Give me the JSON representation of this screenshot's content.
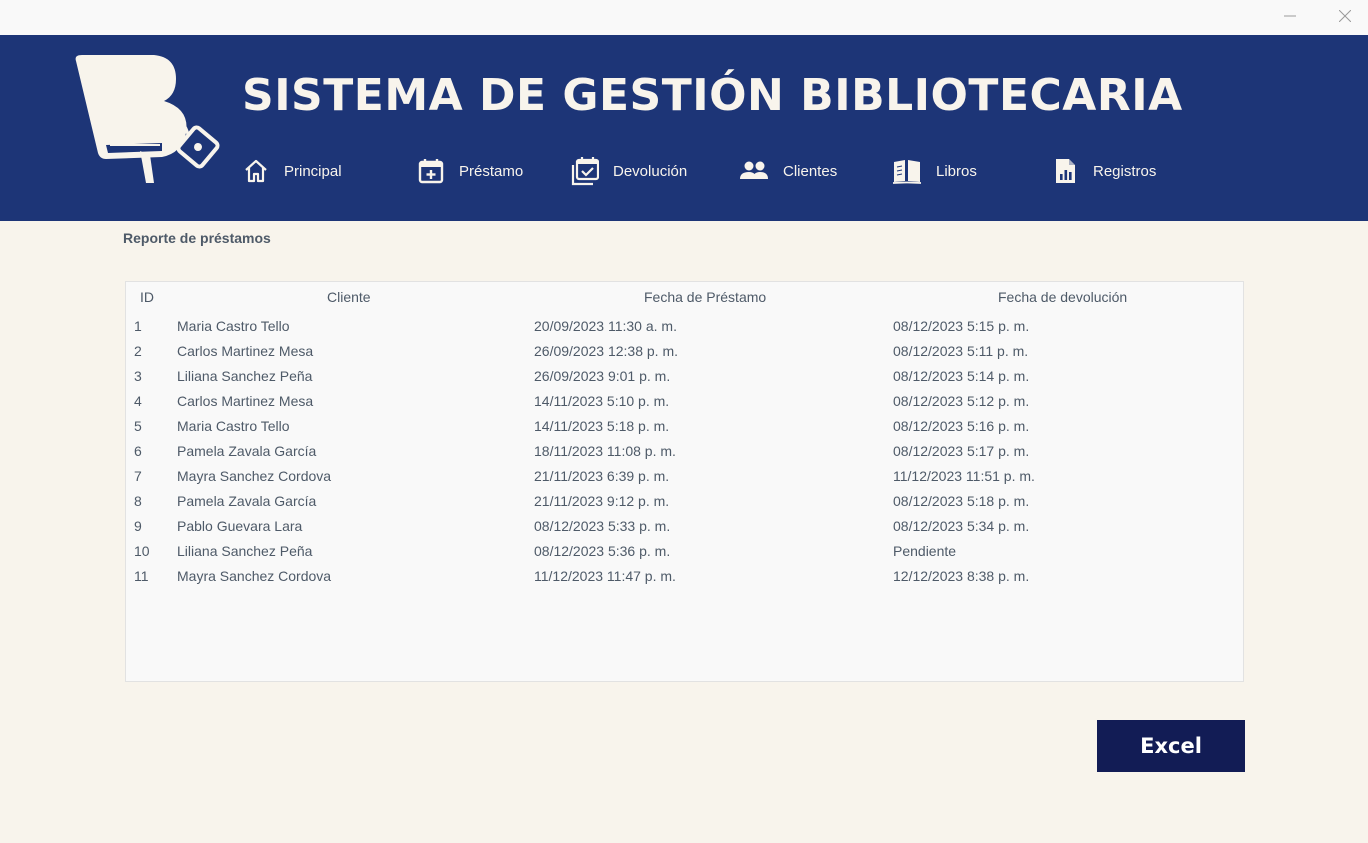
{
  "window": {
    "minimize_icon": "minimize-icon",
    "close_icon": "close-icon"
  },
  "header": {
    "title": "SISTEMA DE GESTIÓN BIBLIOTECARIA",
    "logo_letter": "B",
    "nav": [
      {
        "label": "Principal",
        "icon": "home-icon"
      },
      {
        "label": "Préstamo",
        "icon": "calendar-add-icon"
      },
      {
        "label": "Devolución",
        "icon": "calendar-check-icon"
      },
      {
        "label": "Clientes",
        "icon": "users-icon"
      },
      {
        "label": "Libros",
        "icon": "book-icon"
      },
      {
        "label": "Registros",
        "icon": "report-icon"
      }
    ]
  },
  "report": {
    "title": "Reporte de préstamos",
    "columns": [
      "ID",
      "Cliente",
      "Fecha de Préstamo",
      "Fecha de devolución"
    ],
    "rows": [
      [
        "1",
        "Maria Castro Tello",
        "20/09/2023 11:30 a. m.",
        "08/12/2023 5:15 p. m."
      ],
      [
        "2",
        "Carlos Martinez Mesa",
        "26/09/2023 12:38 p. m.",
        "08/12/2023 5:11 p. m."
      ],
      [
        "3",
        "Liliana Sanchez Peña",
        "26/09/2023 9:01 p. m.",
        "08/12/2023 5:14 p. m."
      ],
      [
        "4",
        "Carlos Martinez Mesa",
        "14/11/2023 5:10 p. m.",
        "08/12/2023 5:12 p. m."
      ],
      [
        "5",
        "Maria Castro Tello",
        "14/11/2023 5:18 p. m.",
        "08/12/2023 5:16 p. m."
      ],
      [
        "6",
        "Pamela Zavala García",
        "18/11/2023 11:08 p. m.",
        "08/12/2023 5:17 p. m."
      ],
      [
        "7",
        "Mayra Sanchez Cordova",
        "21/11/2023 6:39 p. m.",
        "11/12/2023 11:51 p. m."
      ],
      [
        "8",
        "Pamela Zavala García",
        "21/11/2023 9:12 p. m.",
        "08/12/2023 5:18 p. m."
      ],
      [
        "9",
        "Pablo Guevara Lara",
        "08/12/2023 5:33 p. m.",
        "08/12/2023 5:34 p. m."
      ],
      [
        "10",
        "Liliana Sanchez Peña",
        "08/12/2023 5:36 p. m.",
        "Pendiente"
      ],
      [
        "11",
        "Mayra Sanchez Cordova",
        "11/12/2023 11:47 p. m.",
        "12/12/2023 8:38 p. m."
      ]
    ]
  },
  "actions": {
    "excel_label": "Excel"
  },
  "colors": {
    "header_bg": "#1d3577",
    "page_bg": "#f8f4ec",
    "table_bg": "#f9f9f9",
    "text": "#4e5a68",
    "excel_button_bg": "#121c55"
  }
}
